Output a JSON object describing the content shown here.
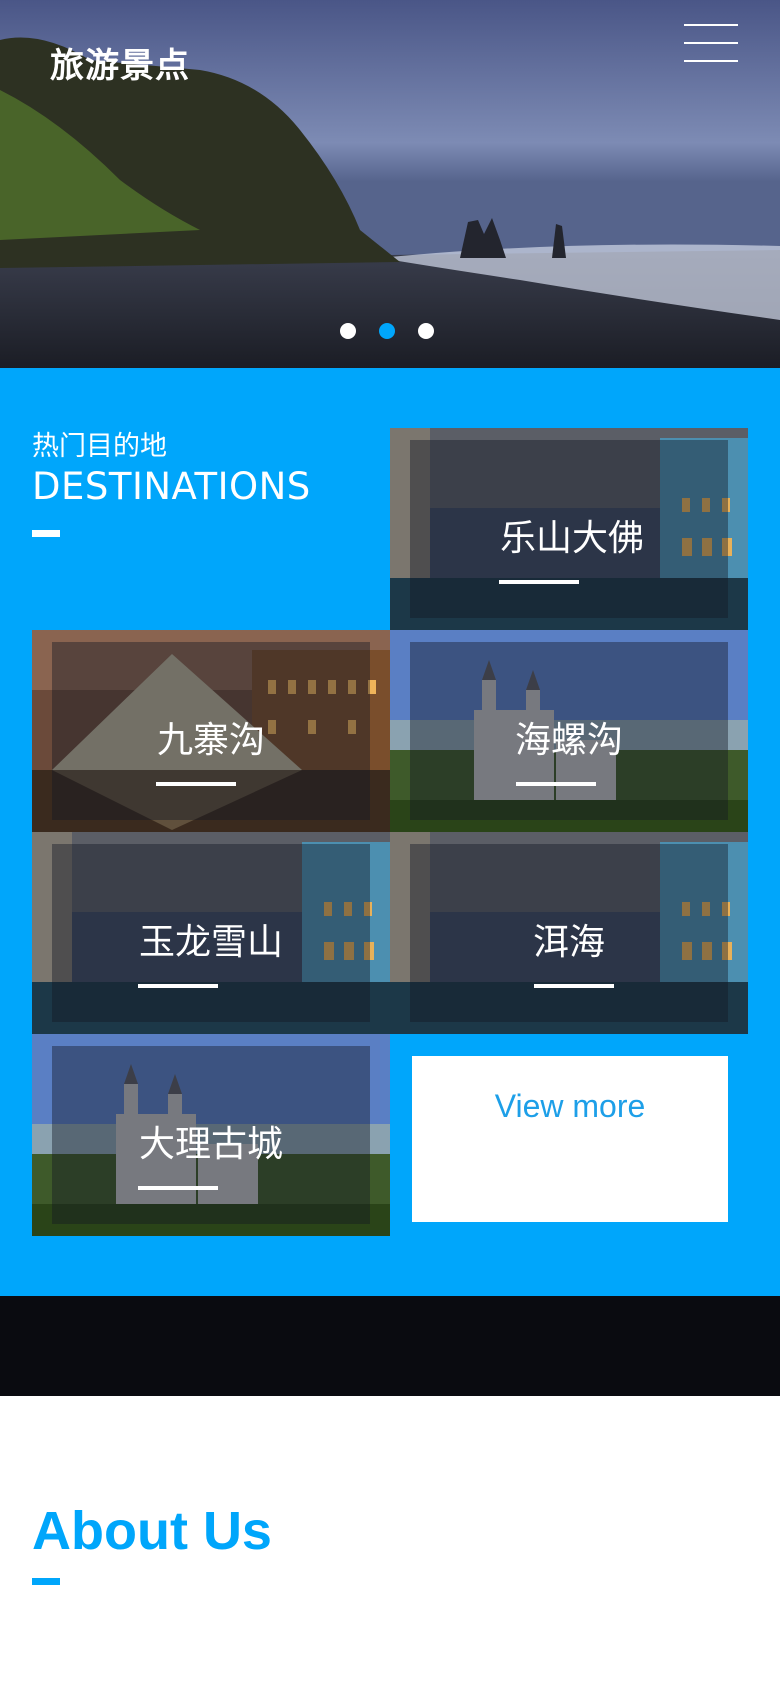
{
  "header": {
    "logo_text": "旅游景点",
    "menu_icon": "hamburger-menu-icon"
  },
  "hero": {
    "slides": 3,
    "active_slide": 2
  },
  "destinations": {
    "title_cn": "热门目的地",
    "title_en": "DESTINATIONS",
    "tiles": [
      {
        "label": "乐山大佛",
        "scene": "venice-canal"
      },
      {
        "label": "九寨沟",
        "scene": "louvre-pyramid"
      },
      {
        "label": "海螺沟",
        "scene": "castle"
      },
      {
        "label": "玉龙雪山",
        "scene": "venice-canal"
      },
      {
        "label": "洱海",
        "scene": "venice-canal"
      },
      {
        "label": "大理古城",
        "scene": "castle"
      }
    ],
    "view_more": "View more"
  },
  "about": {
    "title": "About Us"
  },
  "colors": {
    "accent": "#00a6fb",
    "dark_strip": "#0a0b10",
    "view_more_text": "#1d9fe8"
  }
}
